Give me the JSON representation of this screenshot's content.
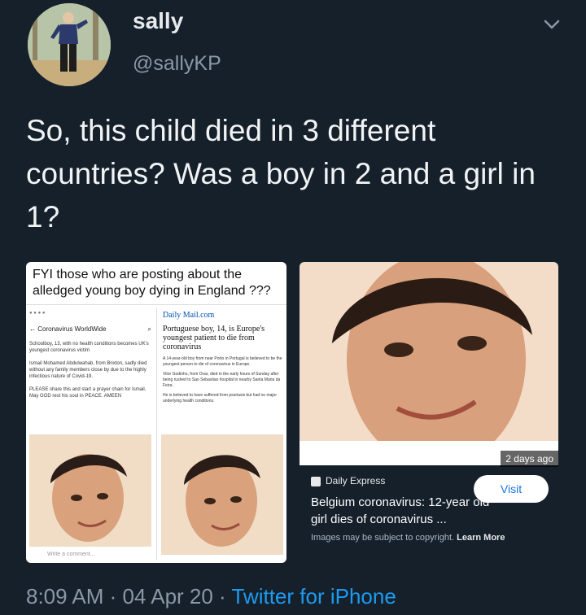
{
  "user": {
    "name": "sally",
    "handle": "@sallyKP"
  },
  "tweet": {
    "text": "So, this child died in 3 different countries? Was a boy in 2 and a girl in 1?"
  },
  "footer": {
    "time": "8:09 AM",
    "sep1": " · ",
    "date": "04 Apr 20",
    "sep2": " · ",
    "source": "Twitter for iPhone"
  },
  "image1": {
    "caption": "FYI those who are posting about the alledged young boy dying in England ???",
    "left_post": {
      "header": "Coronavirus WorldWide",
      "p1": "Schoolboy, 13, with no health conditions becomes UK's youngest coronavirus victim",
      "p2": "Ismail Mohamed Abdulwahab, from Brixton, sadly died without any family members close by due to the highly infectious nature of Covid-19.",
      "p3": "PLEASE share this and start a prayer chain for Ismail. May GOD rest his soul in PEACE. AMEEN",
      "comment": "Write a comment..."
    },
    "right_post": {
      "brand": "Daily Mail.com",
      "headline": "Portuguese boy, 14, is Europe's youngest patient to die from coronavirus",
      "p1": "A 14-year-old boy from near Porto in Portugal is believed to be the youngest person to die of coronavirus in Europe.",
      "p2": "Vitor Godinho, from Ovar, died in the early hours of Sunday after being rushed to Sao Sebastiao hospital in nearby Santa Maria da Feira.",
      "p3": "He is believed to have suffered from psoriasis but had no major underlying health conditions."
    }
  },
  "image2": {
    "age": "2 days ago",
    "source": "Daily Express",
    "title": "Belgium coronavirus: 12-year old girl dies of coronavirus ...",
    "visit": "Visit",
    "copyright": "Images may be subject to copyright.",
    "learn_more": "Learn More"
  },
  "colors": {
    "background": "#15202b",
    "link": "#1d9bf0",
    "muted": "#8b98a5"
  }
}
